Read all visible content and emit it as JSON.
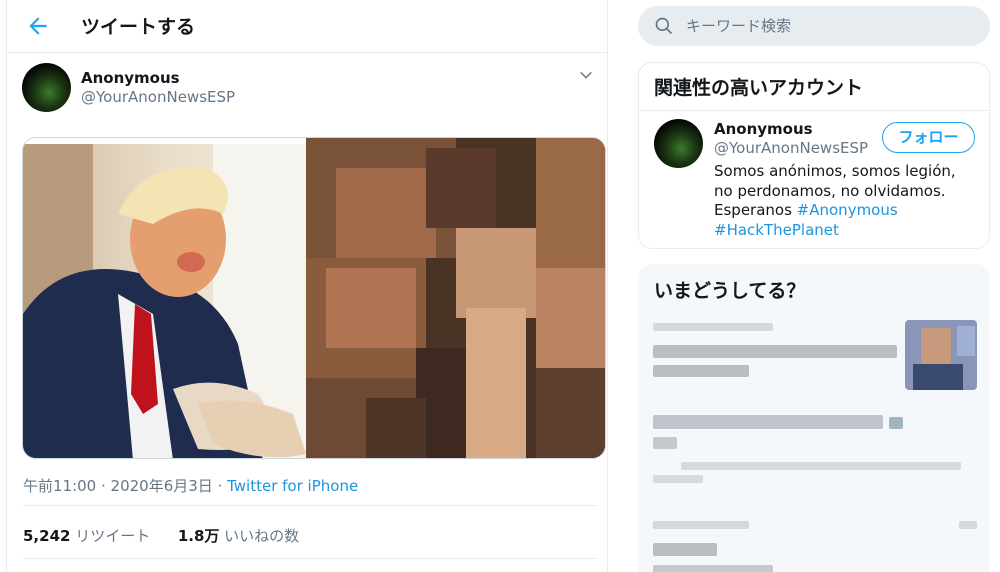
{
  "header": {
    "title": "ツイートする"
  },
  "tweet": {
    "author_name": "Anonymous",
    "author_handle": "@YourAnonNewsESP",
    "timestamp": "午前11:00 · 2020年6月3日 · ",
    "client": "Twitter for iPhone",
    "retweets_count": "5,242",
    "retweets_label": "リツイート",
    "likes_count": "1.8万",
    "likes_label": "いいねの数"
  },
  "search": {
    "placeholder": "キーワード検索"
  },
  "related": {
    "title": "関連性の高いアカウント",
    "name": "Anonymous",
    "handle": "@YourAnonNewsESP",
    "follow_label": "フォロー",
    "bio_text": "Somos anónimos, somos legión, no perdonamos, no olvidamos. Esperanos ",
    "hashtag1": "#Anonymous",
    "hashtag2": "#HackThePlanet"
  },
  "trends": {
    "title": "いまどうしてる？"
  },
  "colors": {
    "accent": "#1da1f2",
    "link": "#1b95e0",
    "secondary_text": "#657786",
    "border": "#e6ecf0"
  }
}
